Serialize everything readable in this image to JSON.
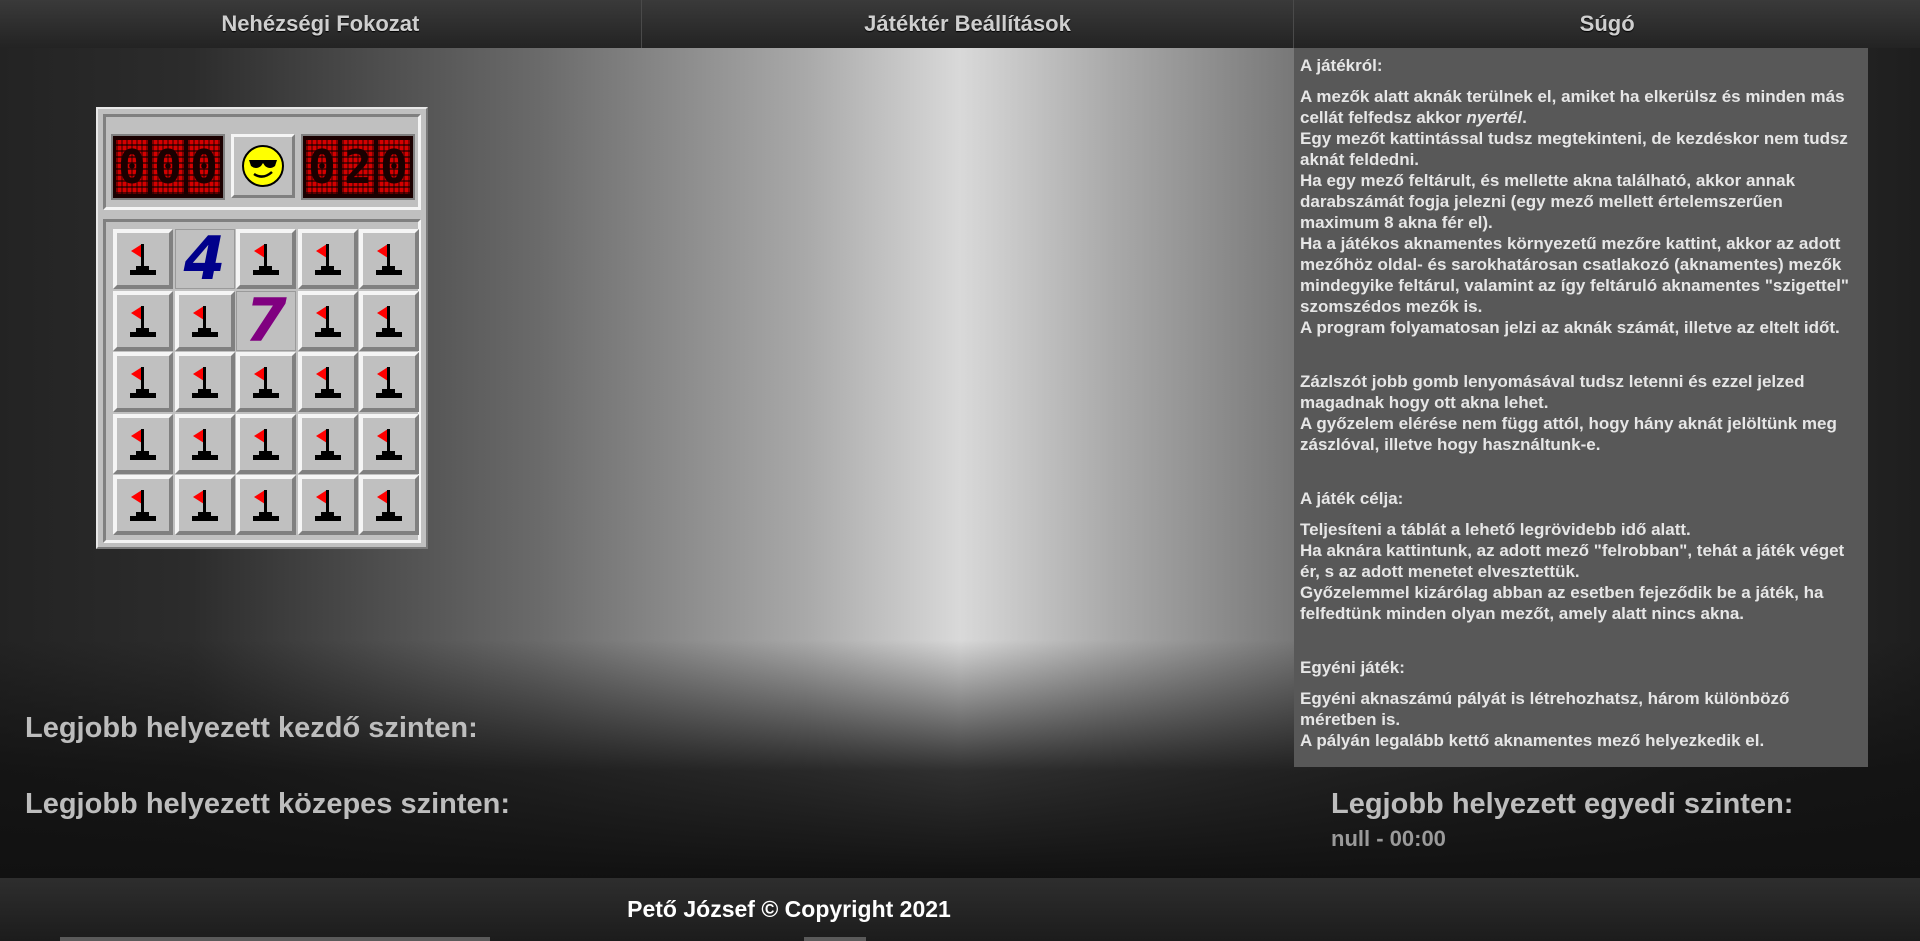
{
  "nav": {
    "items": [
      {
        "label": "Nehézségi Fokozat"
      },
      {
        "label": "Játéktér Beállítások"
      },
      {
        "label": "Súgó"
      }
    ]
  },
  "game": {
    "mine_counter": "000",
    "timer": "020",
    "smiley": "cool-smiley-icon",
    "board": [
      [
        "flag",
        "4",
        "flag",
        "flag",
        "flag"
      ],
      [
        "flag",
        "flag",
        "7",
        "flag",
        "flag"
      ],
      [
        "flag",
        "flag",
        "flag",
        "flag",
        "flag"
      ],
      [
        "flag",
        "flag",
        "flag",
        "flag",
        "flag"
      ],
      [
        "flag",
        "flag",
        "flag",
        "flag",
        "flag"
      ]
    ],
    "colors": {
      "four": "#00008b",
      "seven": "#800080",
      "flag": "#ff0000",
      "lcd": "#d40000"
    }
  },
  "help": {
    "about_title": "A játékról:",
    "about_lines": [
      "A mezők alatt aknák terülnek el, amiket ha elkerülsz és minden más cellát felfedsz akkor",
      "nyertél",
      ".",
      "Egy mezőt kattintással tudsz megtekinteni, de kezdéskor nem tudsz aknát feldedni.",
      "Ha egy mező feltárult, és mellette akna található, akkor annak darabszámát fogja jelezni (egy mező mellett értelemszerűen maximum 8 akna fér el).",
      "Ha a játékos aknamentes környezetű mezőre kattint, akkor az adott mezőhöz oldal- és sarokhatárosan csatlakozó (aknamentes) mezők mindegyike feltárul, valamint az így feltáruló aknamentes \"szigettel\" szomszédos mezők is.",
      "A program folyamatosan jelzi az aknák számát, illetve az eltelt időt."
    ],
    "flag_lines": [
      "Zázlszót jobb gomb lenyomásával tudsz letenni és ezzel jelzed magadnak hogy ott akna lehet.",
      "A győzelem elérése nem függ attól, hogy hány aknát jelöltünk meg zászlóval, illetve hogy használtunk-e."
    ],
    "goal_title": "A játék célja:",
    "goal_lines": [
      "Teljesíteni a táblát a lehető legrövidebb idő alatt.",
      "Ha aknára kattintunk, az adott mező \"felrobban\", tehát a játék véget ér, s az adott menetet elvesztettük.",
      "Győzelemmel kizárólag abban az esetben fejeződik be a játék, ha felfedtünk minden olyan mezőt, amely alatt nincs akna."
    ],
    "custom_title": "Egyéni játék:",
    "custom_lines": [
      "Egyéni aknaszámú pályát is létrehozhatsz, három különböző méretben is.",
      "A pályán legalább kettő aknamentes mező helyezkedik el."
    ]
  },
  "best": {
    "beginner": "Legjobb helyezett kezdő szinten:",
    "intermediate": "Legjobb helyezett közepes szinten:",
    "custom": "Legjobb helyezett egyedi szinten:",
    "custom_value": "null - 00:00"
  },
  "footer": {
    "text": "Pető József © Copyright 2021"
  }
}
